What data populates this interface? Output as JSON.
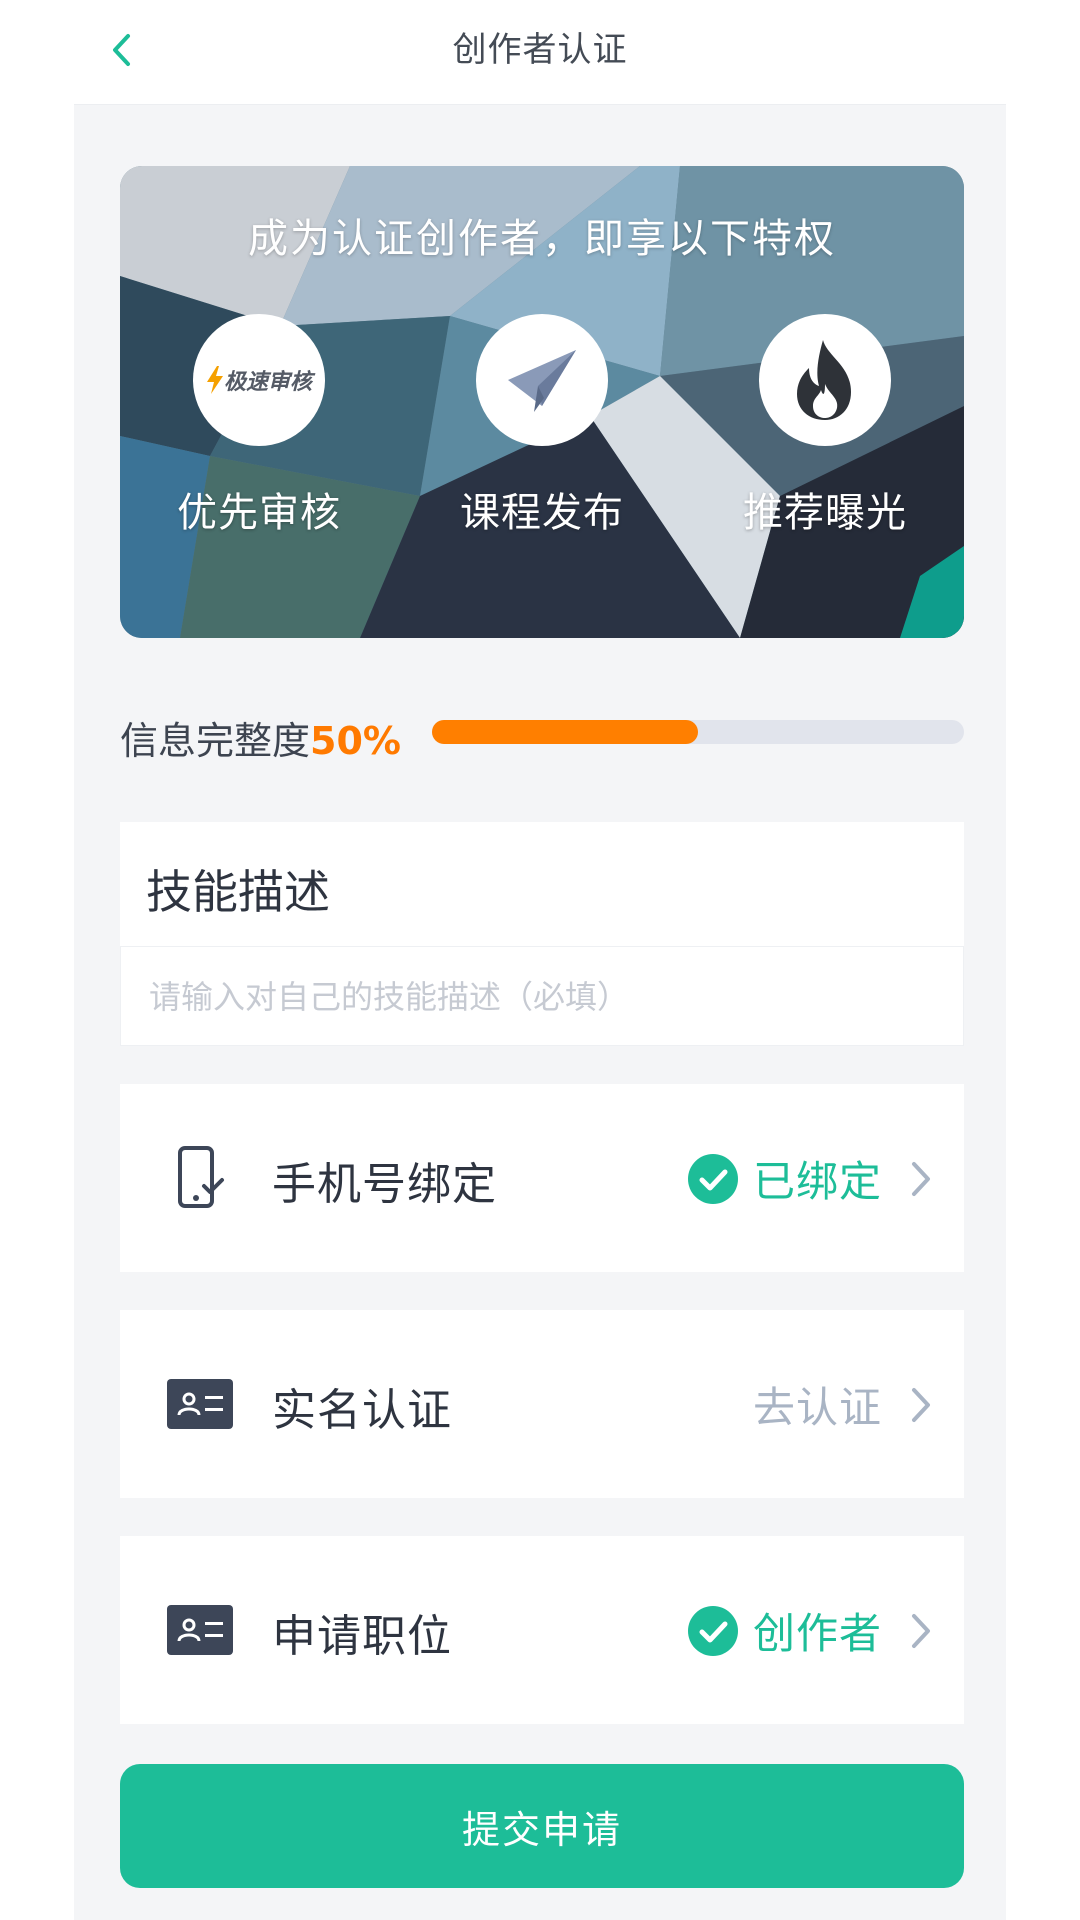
{
  "header": {
    "title": "创作者认证",
    "back_icon": "chevron-left-icon",
    "accent_color": "#1dbd98"
  },
  "banner": {
    "headline": "成为认证创作者，即享以下特权",
    "perks": [
      {
        "label": "优先审核",
        "badge_text": "极速审核",
        "icon": "lightning-icon"
      },
      {
        "label": "课程发布",
        "icon": "paper-plane-icon"
      },
      {
        "label": "推荐曝光",
        "icon": "flame-icon"
      }
    ]
  },
  "progress": {
    "label": "信息完整度",
    "percent_text": "50%",
    "value": 0.5,
    "fill_color": "#ff7f00"
  },
  "skill": {
    "title": "技能描述",
    "placeholder": "请输入对自己的技能描述（必填）",
    "value": ""
  },
  "rows": [
    {
      "label": "手机号绑定",
      "status": "已绑定",
      "state": "done",
      "icon": "phone-check-icon"
    },
    {
      "label": "实名认证",
      "status": "去认证",
      "state": "todo",
      "icon": "id-card-icon"
    },
    {
      "label": "申请职位",
      "status": "创作者",
      "state": "done",
      "icon": "id-card-icon"
    }
  ],
  "submit": {
    "label": "提交申请"
  }
}
